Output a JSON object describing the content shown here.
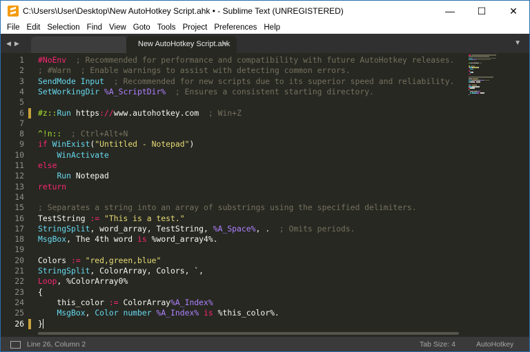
{
  "window": {
    "title": "C:\\Users\\User\\Desktop\\New AutoHotkey Script.ahk • - Sublime Text (UNREGISTERED)",
    "controls": {
      "minimize": "—",
      "maximize": "☐",
      "close": "✕"
    }
  },
  "menu": [
    "File",
    "Edit",
    "Selection",
    "Find",
    "View",
    "Goto",
    "Tools",
    "Project",
    "Preferences",
    "Help"
  ],
  "tabs": {
    "inactive_label": "",
    "active_label": "New AutoHotkey Script.ahk",
    "modified_marker": "●",
    "nav_left": "◀",
    "nav_right": "▶",
    "menu_arrow": "▼"
  },
  "editor": {
    "current_line": 26,
    "lines": [
      {
        "n": "1",
        "tokens": [
          {
            "t": "#NoEnv",
            "c": "kw"
          },
          {
            "t": "  ; Recommended for performance and compatibility with future AutoHotkey releases.",
            "c": "cmt"
          }
        ]
      },
      {
        "n": "2",
        "tokens": [
          {
            "t": "; #Warn  ; Enable warnings to assist with detecting common errors.",
            "c": "cmt"
          }
        ]
      },
      {
        "n": "3",
        "tokens": [
          {
            "t": "SendMode Input",
            "c": "fn"
          },
          {
            "t": "  ; Recommended for new scripts due to its superior speed and reliability.",
            "c": "cmt"
          }
        ]
      },
      {
        "n": "4",
        "tokens": [
          {
            "t": "SetWorkingDir ",
            "c": "fn"
          },
          {
            "t": "%A_ScriptDir%",
            "c": "num"
          },
          {
            "t": "  ; Ensures a consistent starting directory.",
            "c": "cmt"
          }
        ]
      },
      {
        "n": "5",
        "tokens": []
      },
      {
        "n": "6",
        "tokens": [
          {
            "t": "#z::",
            "c": "grn"
          },
          {
            "t": "Run ",
            "c": "fn"
          },
          {
            "t": "https",
            "c": "text"
          },
          {
            "t": "://",
            "c": "kw"
          },
          {
            "t": "www.autohotkey.com",
            "c": "text"
          },
          {
            "t": "  ; Win+Z",
            "c": "cmt"
          }
        ]
      },
      {
        "n": "7",
        "tokens": []
      },
      {
        "n": "8",
        "tokens": [
          {
            "t": "^!n::",
            "c": "grn"
          },
          {
            "t": "  ; Ctrl+Alt+N",
            "c": "cmt"
          }
        ]
      },
      {
        "n": "9",
        "tokens": [
          {
            "t": "if ",
            "c": "kw"
          },
          {
            "t": "WinExist",
            "c": "fn"
          },
          {
            "t": "(",
            "c": "text"
          },
          {
            "t": "\"Untitled - Notepad\"",
            "c": "str"
          },
          {
            "t": ")",
            "c": "text"
          }
        ]
      },
      {
        "n": "10",
        "tokens": [
          {
            "t": "    ",
            "c": "text"
          },
          {
            "t": "WinActivate",
            "c": "fn"
          }
        ]
      },
      {
        "n": "11",
        "tokens": [
          {
            "t": "else",
            "c": "kw"
          }
        ]
      },
      {
        "n": "12",
        "tokens": [
          {
            "t": "    ",
            "c": "text"
          },
          {
            "t": "Run ",
            "c": "fn"
          },
          {
            "t": "Notepad",
            "c": "text"
          }
        ]
      },
      {
        "n": "13",
        "tokens": [
          {
            "t": "return",
            "c": "kw"
          }
        ]
      },
      {
        "n": "14",
        "tokens": []
      },
      {
        "n": "15",
        "tokens": [
          {
            "t": "; Separates a string into an array of substrings using the specified delimiters.",
            "c": "cmt"
          }
        ]
      },
      {
        "n": "16",
        "tokens": [
          {
            "t": "TestString ",
            "c": "text"
          },
          {
            "t": ":=",
            "c": "kw"
          },
          {
            "t": " ",
            "c": "text"
          },
          {
            "t": "\"This is a test.\"",
            "c": "str"
          }
        ]
      },
      {
        "n": "17",
        "tokens": [
          {
            "t": "StringSplit",
            "c": "fn"
          },
          {
            "t": ", word_array, TestString, ",
            "c": "text"
          },
          {
            "t": "%A_Space%",
            "c": "num"
          },
          {
            "t": ", .",
            "c": "text"
          },
          {
            "t": "  ; Omits periods.",
            "c": "cmt"
          }
        ]
      },
      {
        "n": "18",
        "tokens": [
          {
            "t": "MsgBox",
            "c": "fn"
          },
          {
            "t": ", The 4th word ",
            "c": "text"
          },
          {
            "t": "is",
            "c": "kw"
          },
          {
            "t": " %word_array4%.",
            "c": "text"
          }
        ]
      },
      {
        "n": "19",
        "tokens": []
      },
      {
        "n": "20",
        "tokens": [
          {
            "t": "Colors ",
            "c": "text"
          },
          {
            "t": ":=",
            "c": "kw"
          },
          {
            "t": " ",
            "c": "text"
          },
          {
            "t": "\"red,green,blue\"",
            "c": "str"
          }
        ]
      },
      {
        "n": "21",
        "tokens": [
          {
            "t": "StringSplit",
            "c": "fn"
          },
          {
            "t": ", ColorArray, Colors, `,",
            "c": "text"
          }
        ]
      },
      {
        "n": "22",
        "tokens": [
          {
            "t": "Loop",
            "c": "kw"
          },
          {
            "t": ", %ColorArray0%",
            "c": "text"
          }
        ]
      },
      {
        "n": "23",
        "tokens": [
          {
            "t": "{",
            "c": "text"
          }
        ]
      },
      {
        "n": "24",
        "tokens": [
          {
            "t": "    this_color ",
            "c": "text"
          },
          {
            "t": ":=",
            "c": "kw"
          },
          {
            "t": " ColorArray",
            "c": "text"
          },
          {
            "t": "%A_Index%",
            "c": "num"
          }
        ]
      },
      {
        "n": "25",
        "tokens": [
          {
            "t": "    ",
            "c": "text"
          },
          {
            "t": "MsgBox",
            "c": "fn"
          },
          {
            "t": ", ",
            "c": "text"
          },
          {
            "t": "Color number ",
            "c": "fn"
          },
          {
            "t": "%A_Index%",
            "c": "num"
          },
          {
            "t": " ",
            "c": "text"
          },
          {
            "t": "is",
            "c": "kw"
          },
          {
            "t": " %this_color%.",
            "c": "text"
          }
        ]
      },
      {
        "n": "26",
        "tokens": [
          {
            "t": "}",
            "c": "text"
          }
        ]
      }
    ]
  },
  "status": {
    "position": "Line 26, Column 2",
    "tab_size": "Tab Size: 4",
    "syntax": "AutoHotkey"
  },
  "colors": {
    "background": "#272822",
    "comment": "#75715e",
    "keyword": "#f92672",
    "function": "#66d9ef",
    "string": "#e6db74",
    "variable": "#ae81ff",
    "label": "#a6e22e"
  }
}
